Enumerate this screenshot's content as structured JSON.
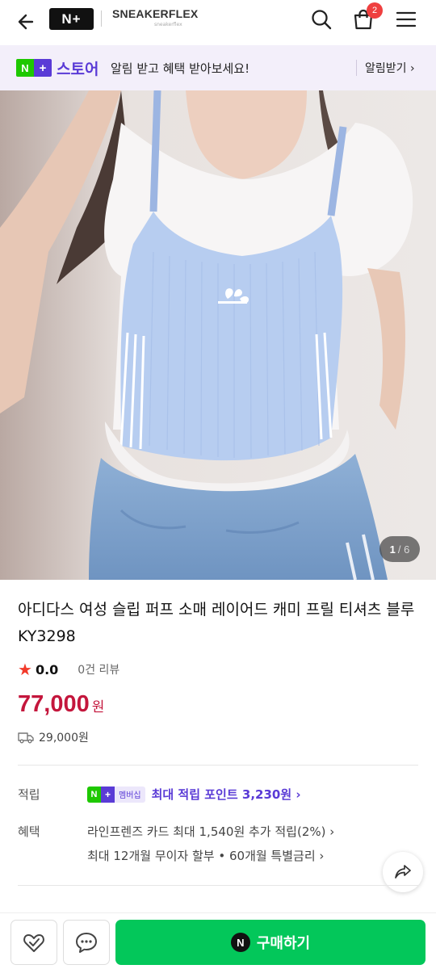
{
  "header": {
    "back_icon": "arrow-left-icon",
    "logo_text": "N+",
    "brand_name": "SNEAKERFLEX",
    "brand_sub": "sneakerflex",
    "search_icon": "search-icon",
    "cart_icon": "shopping-bag-icon",
    "cart_count": "2",
    "menu_icon": "hamburger-menu-icon"
  },
  "store_banner": {
    "logo_n": "N",
    "logo_plus": "+",
    "store_name": "스토어",
    "message": "알림 받고 혜택 받아보세요!",
    "link_label": "알림받기 ›"
  },
  "gallery": {
    "current": "1",
    "total": "/ 6"
  },
  "product": {
    "title": "아디다스 여성 슬립 퍼프 소매 레이어드 캐미 프릴 티셔츠 블루 KY3298",
    "rating": "0.0",
    "reviews": "0건 리뷰",
    "price": "77,000",
    "price_unit": "원",
    "shipping_fee": "29,000원"
  },
  "details": {
    "points_label": "적립",
    "membership_badge": "멤버십",
    "points_text": "최대 적립 포인트 3,230원 ›",
    "benefit_label": "혜택",
    "benefit_1": "라인프렌즈 카드 최대 1,540원 추가 적립(2%) ›",
    "benefit_2": "최대 12개월 무이자 할부 • 60개월 특별금리 ›"
  },
  "bottom_bar": {
    "wish_icon": "heart-check-icon",
    "talk_icon": "chat-bubble-icon",
    "share_icon": "share-icon",
    "npay_logo": "N",
    "buy_label": "구매하기"
  },
  "colors": {
    "naver_green": "#03c75a",
    "store_purple": "#5a3bd6",
    "price_red": "#c4163c",
    "badge_red": "#ef3f3f",
    "banner_bg": "#f3effa"
  }
}
